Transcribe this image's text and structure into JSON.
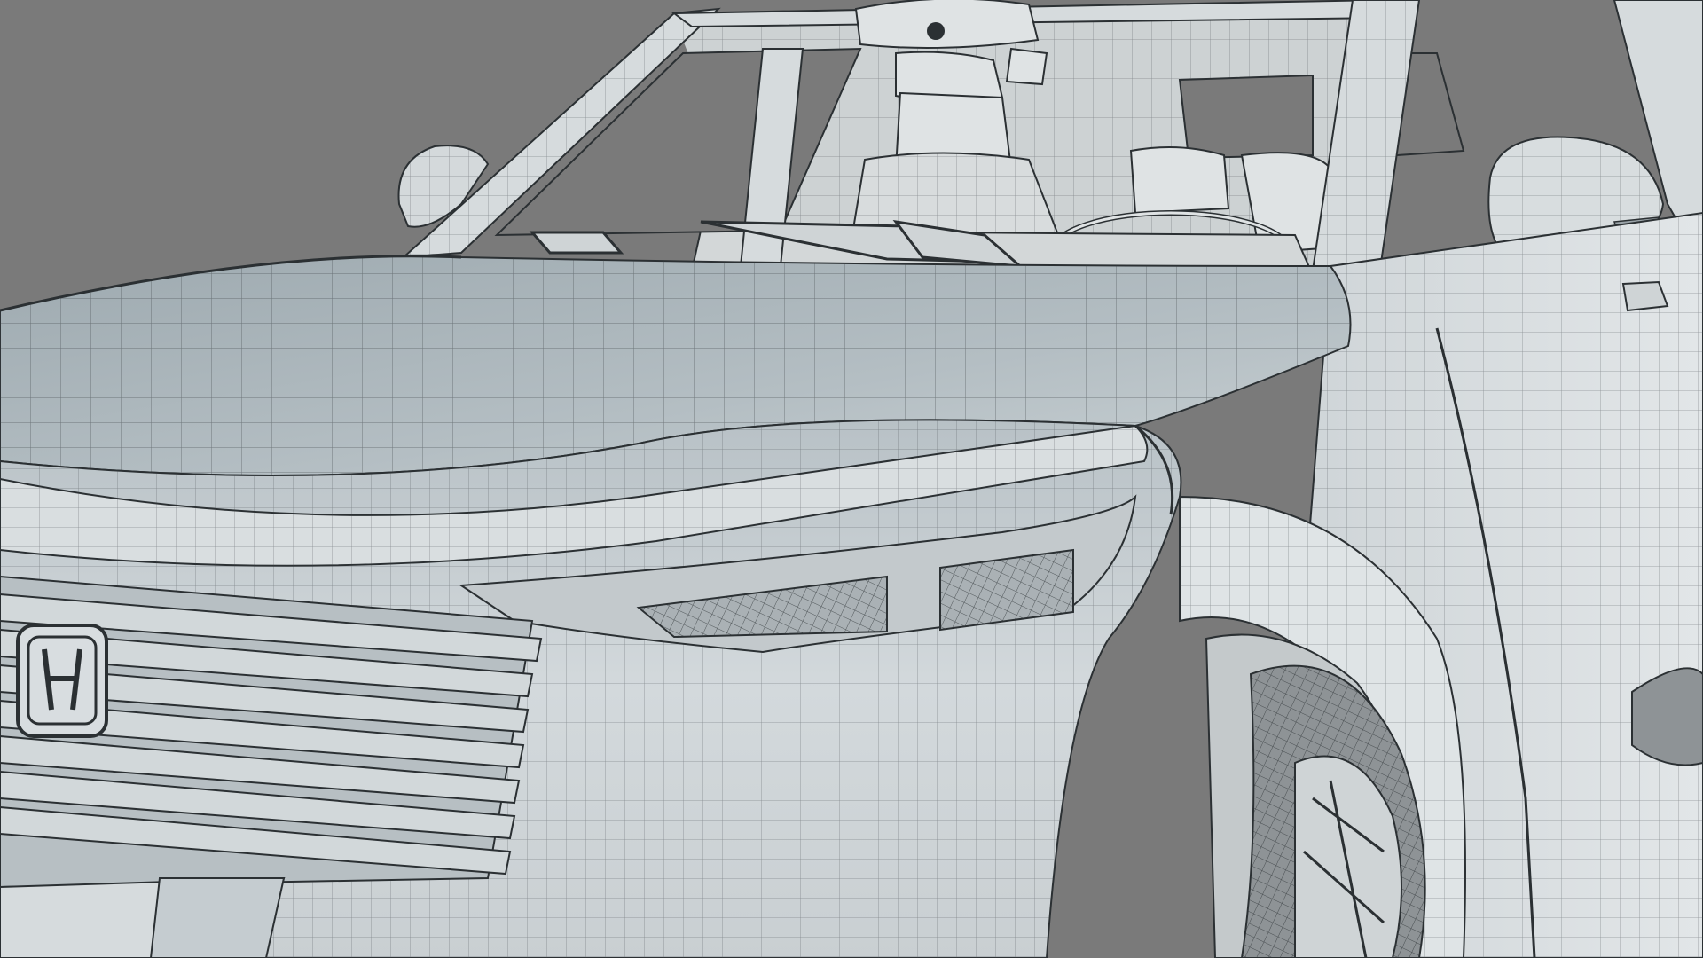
{
  "scene": {
    "subject": "car-wireframe-render",
    "colors": {
      "background": "#7a7a7a",
      "body": "#c7ced2",
      "body_light": "#dfe4e6",
      "body_shadow": "#9aa3a8",
      "glass_void": "#7a7a7a",
      "interior": "#d6d8d8",
      "wire": "#2b3033",
      "wire_light": "#5a6166",
      "tire": "#8e9396",
      "headlight": "#b9c0c3"
    },
    "icons": {
      "emblem": "brand-emblem-icon"
    }
  }
}
